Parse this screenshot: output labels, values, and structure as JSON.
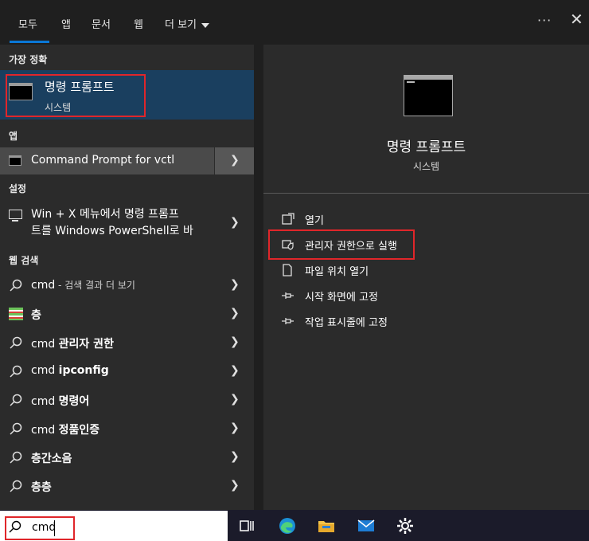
{
  "tabs": [
    {
      "label": "모두",
      "active": true
    },
    {
      "label": "앱"
    },
    {
      "label": "문서"
    },
    {
      "label": "웹"
    },
    {
      "label": "더 보기"
    }
  ],
  "top_actions": {
    "more_options": "···",
    "close": "✕"
  },
  "left": {
    "best_match_header": "가장 정확",
    "best_match": {
      "title": "명령 프롬프트",
      "subtitle": "시스템"
    },
    "apps_header": "앱",
    "app_item": "Command Prompt for vctl",
    "settings_header": "설정",
    "settings_item": {
      "line1": "Win + X 메뉴에서 명령 프롬프",
      "line2": "트를 Windows PowerShell로 바"
    },
    "web_header": "웹 검색",
    "web_items": [
      {
        "prefix": "cmd",
        "suffix": " - 검색 결과 더 보기"
      },
      {
        "prefix": "",
        "bold": "층"
      },
      {
        "prefix": "cmd ",
        "bold": "관리자 권한"
      },
      {
        "prefix": "cmd ",
        "bold": "ipconfig"
      },
      {
        "prefix": "cmd ",
        "bold": "명령어"
      },
      {
        "prefix": "cmd ",
        "bold": "정품인증"
      },
      {
        "prefix": "",
        "bold": "층간소음"
      },
      {
        "prefix": "",
        "bold": "층층"
      }
    ]
  },
  "right": {
    "title": "명령 프롬프트",
    "subtitle": "시스템",
    "actions": [
      {
        "label": "열기",
        "icon": "open-icon"
      },
      {
        "label": "관리자 권한으로 실행",
        "icon": "shield-icon"
      },
      {
        "label": "파일 위치 열기",
        "icon": "folder-icon"
      },
      {
        "label": "시작 화면에 고정",
        "icon": "pin-icon"
      },
      {
        "label": "작업 표시줄에 고정",
        "icon": "pin-icon"
      }
    ]
  },
  "taskbar": {
    "search_value": "cmd",
    "icons": [
      "task-view-icon",
      "edge-icon",
      "file-explorer-icon",
      "mail-icon",
      "settings-gear-icon"
    ]
  },
  "colors": {
    "accent": "#0a78d7",
    "selection": "#1a3f5f",
    "highlight_box": "#e0262a"
  }
}
